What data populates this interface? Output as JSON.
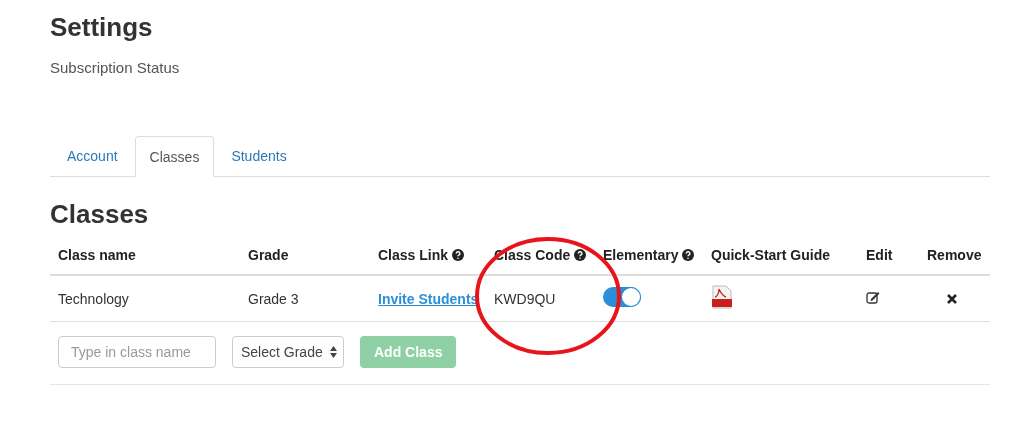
{
  "page": {
    "title": "Settings",
    "subtitle": "Subscription Status"
  },
  "tabs": [
    {
      "label": "Account",
      "selected": false
    },
    {
      "label": "Classes",
      "selected": true
    },
    {
      "label": "Students",
      "selected": false
    }
  ],
  "section_title": "Classes",
  "table": {
    "columns": [
      {
        "label": "Class name",
        "help": false
      },
      {
        "label": "Grade",
        "help": false
      },
      {
        "label": "Class Link",
        "help": true
      },
      {
        "label": "Class Code",
        "help": true
      },
      {
        "label": "Elementary",
        "help": true
      },
      {
        "label": "Quick-Start Guide",
        "help": false
      },
      {
        "label": "Edit",
        "help": false
      },
      {
        "label": "Remove",
        "help": false
      }
    ],
    "rows": [
      {
        "class_name": "Technology",
        "grade": "Grade 3",
        "class_link": "Invite Students",
        "class_code": "KWD9QU",
        "elementary": true
      }
    ]
  },
  "new_class": {
    "name_placeholder": "Type in class name",
    "grade_select": "Select Grade",
    "add_button": "Add Class",
    "add_disabled": true
  },
  "annotation": {
    "kind": "circle"
  }
}
